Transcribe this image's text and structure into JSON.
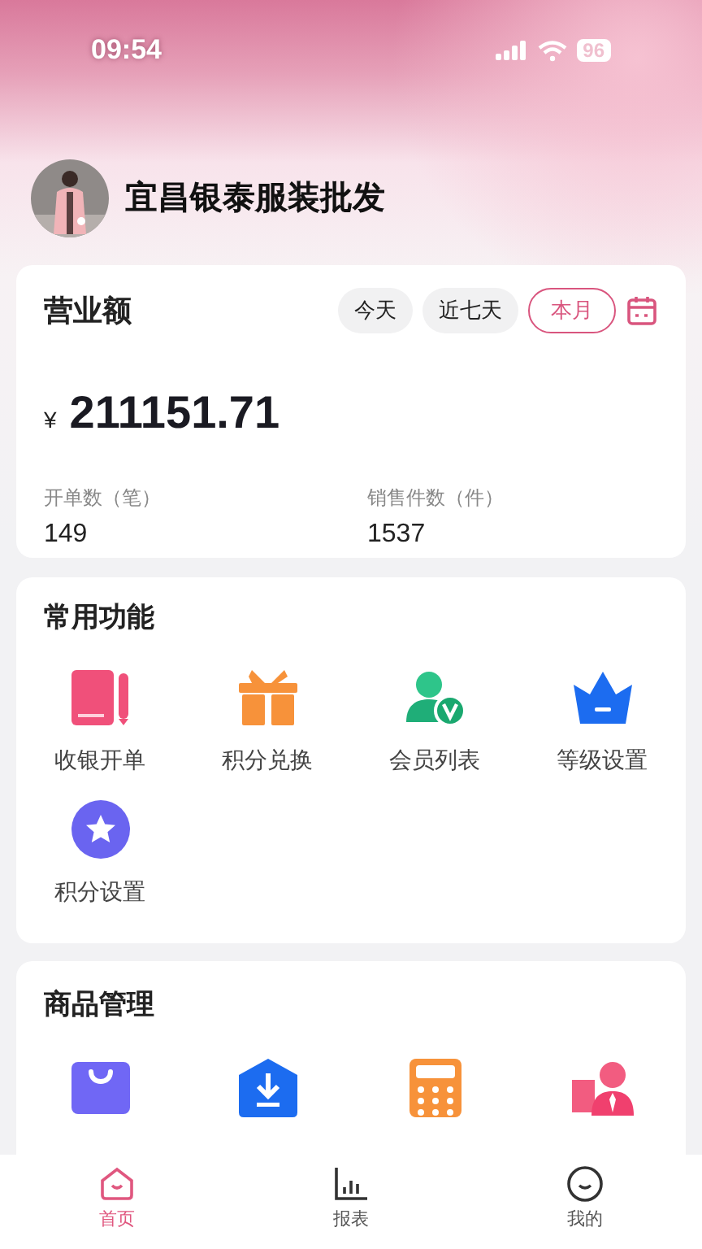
{
  "status_bar": {
    "time": "09:54",
    "battery": "96"
  },
  "store": {
    "name": "宜昌银泰服装批发"
  },
  "revenue": {
    "title": "营业额",
    "tabs": [
      {
        "label": "今天",
        "selected": false
      },
      {
        "label": "近七天",
        "selected": false
      },
      {
        "label": "本月",
        "selected": true
      }
    ],
    "amount_currency": "¥",
    "amount": "211151.71",
    "stats": [
      {
        "label": "开单数（笔）",
        "value": "149"
      },
      {
        "label": "销售件数（件）",
        "value": "1537"
      }
    ]
  },
  "common_functions": {
    "title": "常用功能",
    "items": [
      {
        "label": "收银开单"
      },
      {
        "label": "积分兑换"
      },
      {
        "label": "会员列表"
      },
      {
        "label": "等级设置"
      },
      {
        "label": "积分设置"
      }
    ]
  },
  "product_management": {
    "title": "商品管理"
  },
  "bottom_nav": [
    {
      "label": "首页",
      "selected": true
    },
    {
      "label": "报表",
      "selected": false
    },
    {
      "label": "我的",
      "selected": false
    }
  ]
}
